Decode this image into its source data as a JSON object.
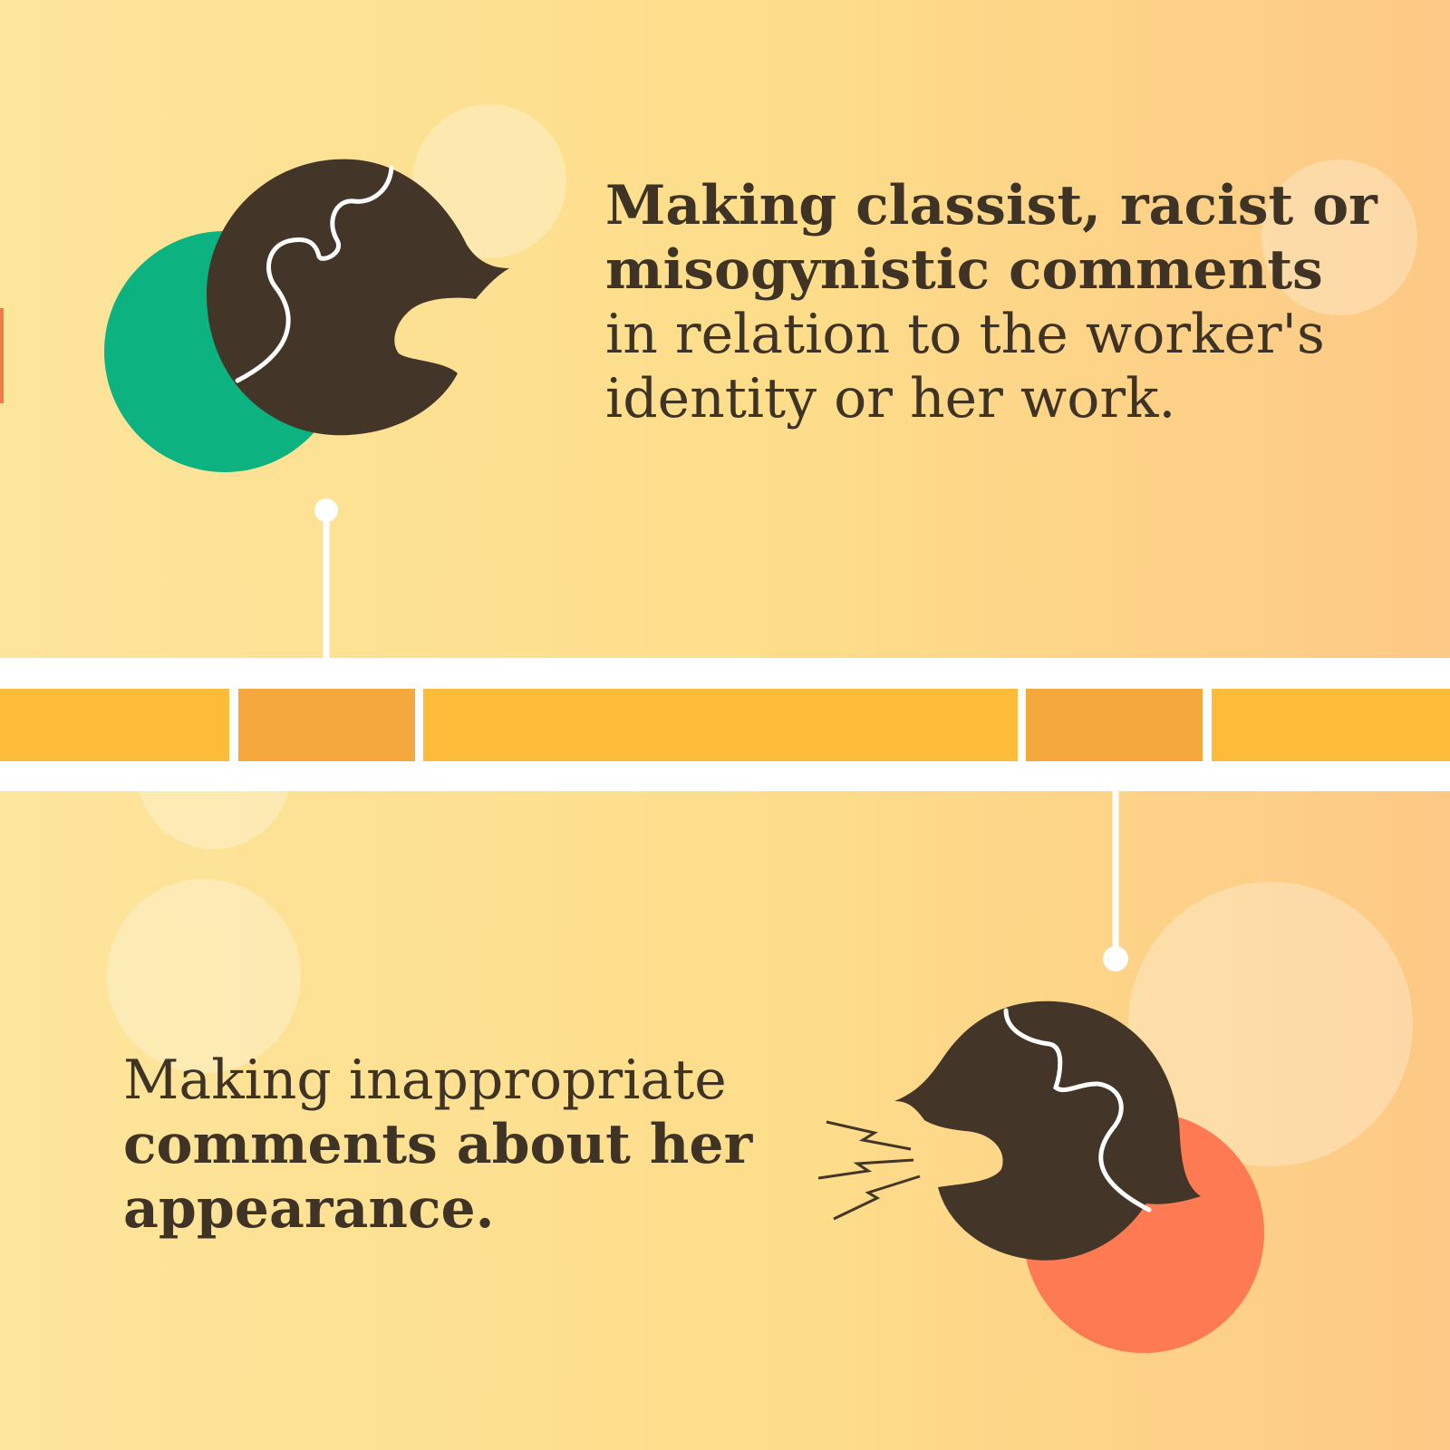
{
  "colors": {
    "background_left": "#fde59c",
    "background_right": "#fdc986",
    "text": "#3f3325",
    "head": "#433628",
    "green_circle": "#0cb27f",
    "coral_circle": "#fd7a52",
    "band_yellow": "#fdbb3a",
    "band_orange": "#f4a83e",
    "band_white": "#ffffff"
  },
  "top_item": {
    "bold_text": "Making classist, racist or misogynistic comments",
    "regular_text": " in relation to the worker's identity or her work.",
    "icon": "speaking-head-icon"
  },
  "bottom_item": {
    "regular_text": "Making inappropriate ",
    "bold_text": "comments about her appearance.",
    "icon": "shouting-head-icon"
  },
  "timeline": {
    "icon": "timeline-band"
  }
}
